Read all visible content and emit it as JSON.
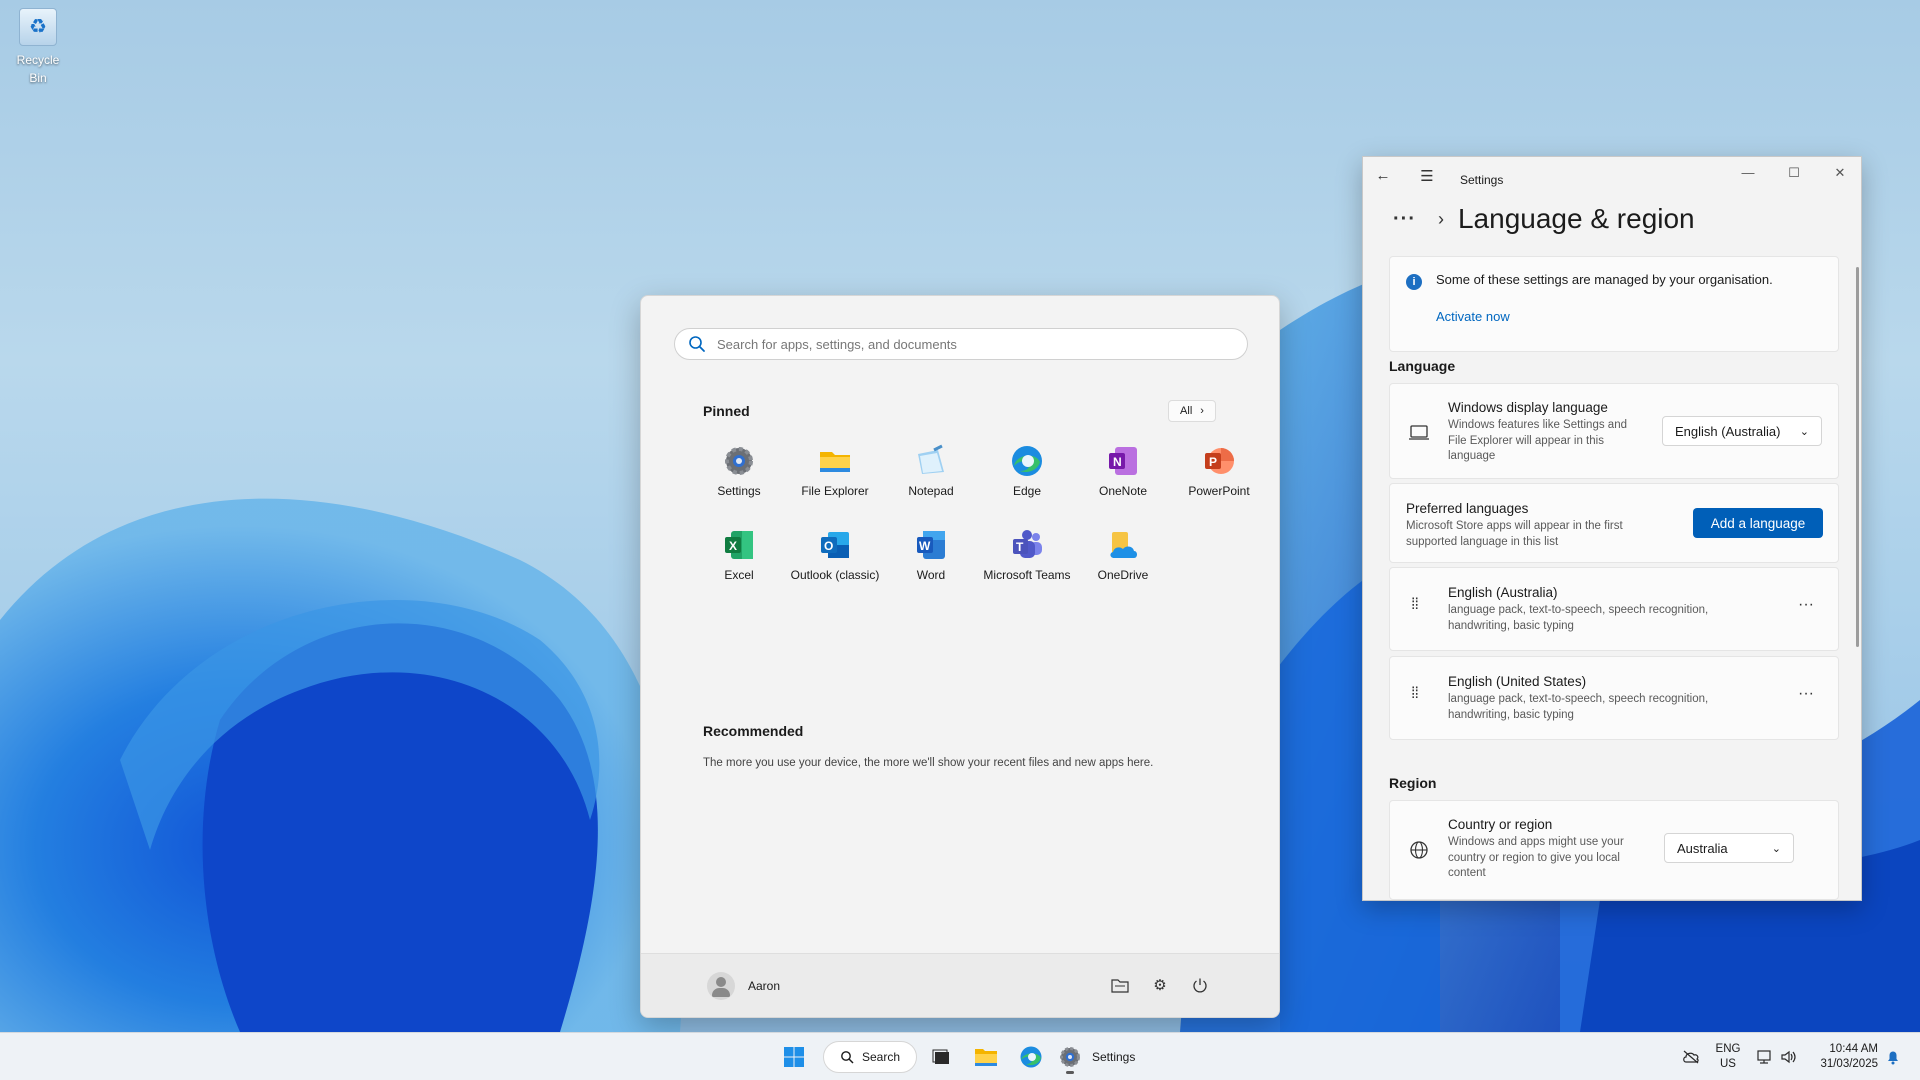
{
  "desktop": {
    "recycle_bin_label": "Recycle Bin"
  },
  "start_menu": {
    "search_placeholder": "Search for apps, settings, and documents",
    "pinned_title": "Pinned",
    "all_label": "All",
    "pinned_apps": [
      {
        "label": "Settings",
        "icon": "settings-gear-icon"
      },
      {
        "label": "File Explorer",
        "icon": "folder-icon"
      },
      {
        "label": "Notepad",
        "icon": "notepad-icon"
      },
      {
        "label": "Edge",
        "icon": "edge-icon"
      },
      {
        "label": "OneNote",
        "icon": "onenote-icon"
      },
      {
        "label": "PowerPoint",
        "icon": "powerpoint-icon"
      },
      {
        "label": "Excel",
        "icon": "excel-icon"
      },
      {
        "label": "Outlook (classic)",
        "icon": "outlook-icon"
      },
      {
        "label": "Word",
        "icon": "word-icon"
      },
      {
        "label": "Microsoft Teams",
        "icon": "teams-icon"
      },
      {
        "label": "OneDrive",
        "icon": "onedrive-icon"
      }
    ],
    "recommended_title": "Recommended",
    "recommended_text": "The more you use your device, the more we'll show your recent files and new apps here.",
    "user_name": "Aaron"
  },
  "settings": {
    "window_title": "Settings",
    "page_title": "Language & region",
    "info_banner": {
      "text": "Some of these settings are managed by your organisation.",
      "link": "Activate now"
    },
    "language_group": "Language",
    "display_language": {
      "title": "Windows display language",
      "subtitle_lines": [
        "Windows features like Settings and",
        "File Explorer will appear in this",
        "language"
      ],
      "value": "English (Australia)"
    },
    "preferred_languages": {
      "title": "Preferred languages",
      "subtitle_lines": [
        "Microsoft Store apps will appear in the first",
        "supported language in this list"
      ],
      "button": "Add a language"
    },
    "languages": [
      {
        "name": "English (Australia)",
        "lines": [
          "language pack, text-to-speech, speech recognition,",
          "handwriting, basic typing"
        ]
      },
      {
        "name": "English (United States)",
        "lines": [
          "language pack, text-to-speech, speech recognition,",
          "handwriting, basic typing"
        ]
      }
    ],
    "region_group": "Region",
    "country": {
      "title": "Country or region",
      "subtitle_lines": [
        "Windows and apps might use your",
        "country or region to give you local",
        "content"
      ],
      "value": "Australia"
    }
  },
  "taskbar": {
    "search_label": "Search",
    "settings_label": "Settings",
    "lang_top": "ENG",
    "lang_bottom": "US",
    "time": "10:44 AM",
    "date": "31/03/2025"
  },
  "colors": {
    "accent": "#005fb8",
    "link": "#0067c0"
  }
}
